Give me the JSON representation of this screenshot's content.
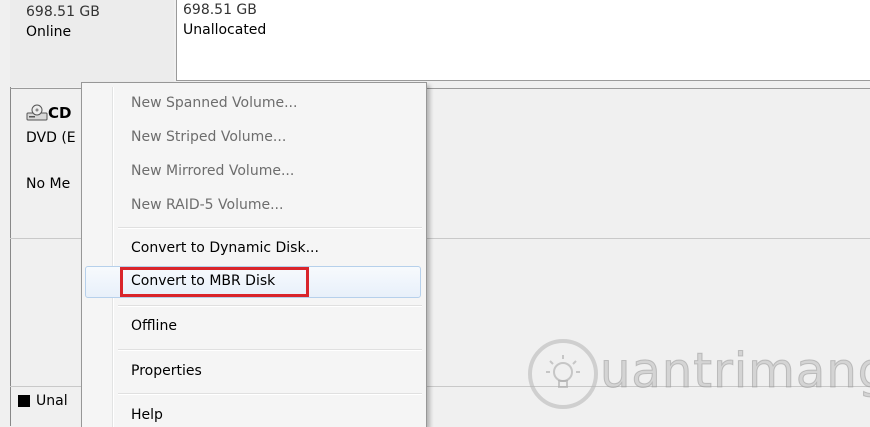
{
  "disk_top": {
    "size_label": "698.51 GB",
    "status": "Online",
    "partition_size": "698.51 GB",
    "partition_status": "Unallocated"
  },
  "cdrom": {
    "name": "CD",
    "type": "DVD (E",
    "media": "No Me",
    "icon": "cdrom-icon"
  },
  "legend": {
    "label": "Unal",
    "color": "#000000"
  },
  "context_menu": {
    "items": [
      {
        "label": "New Spanned Volume...",
        "disabled": true
      },
      {
        "label": "New Striped Volume...",
        "disabled": true
      },
      {
        "label": "New Mirrored Volume...",
        "disabled": true
      },
      {
        "label": "New RAID-5 Volume...",
        "disabled": true
      },
      {
        "label": "Convert to Dynamic Disk...",
        "disabled": false
      },
      {
        "label": "Convert to MBR Disk",
        "disabled": false,
        "highlighted": true
      },
      {
        "label": "Offline",
        "disabled": false
      },
      {
        "label": "Properties",
        "disabled": false
      },
      {
        "label": "Help",
        "disabled": false
      }
    ]
  },
  "watermark": {
    "text": "uantrimang"
  },
  "colors": {
    "highlight_border": "#d9252b"
  }
}
